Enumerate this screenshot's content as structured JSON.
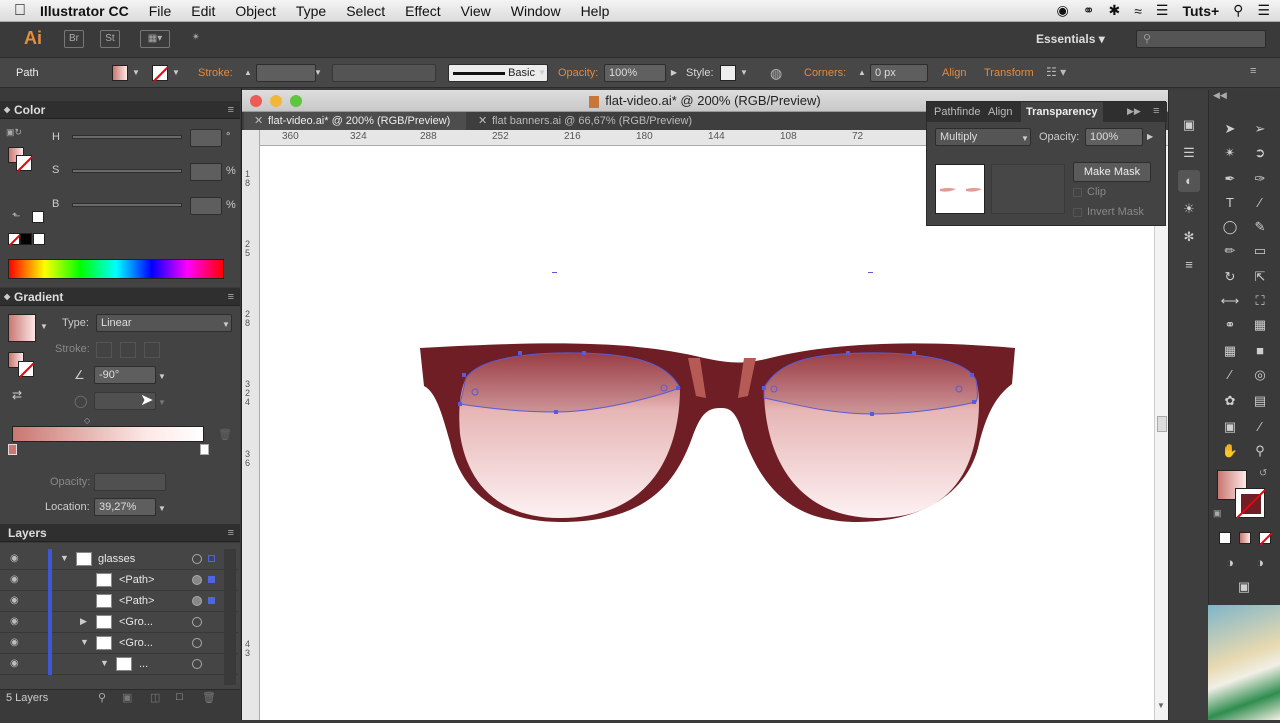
{
  "menubar": {
    "app_name": "Illustrator CC",
    "items": [
      "File",
      "Edit",
      "Object",
      "Type",
      "Select",
      "Effect",
      "View",
      "Window",
      "Help"
    ],
    "right_label": "Tuts+"
  },
  "appbar": {
    "logo": "Ai",
    "bridge_label": "Br",
    "stock_label": "St",
    "workspace": "Essentials",
    "search_placeholder": ""
  },
  "control": {
    "selection_type": "Path",
    "stroke_label": "Stroke:",
    "brush_style": "Basic",
    "opacity_label": "Opacity:",
    "opacity_value": "100%",
    "style_label": "Style:",
    "corners_label": "Corners:",
    "corners_value": "0 px",
    "align_label": "Align",
    "transform_label": "Transform"
  },
  "color_panel": {
    "title": "Color",
    "h_label": "H",
    "s_label": "S",
    "b_label": "B",
    "h_unit": "°",
    "s_unit": "%",
    "b_unit": "%"
  },
  "gradient_panel": {
    "title": "Gradient",
    "type_label": "Type:",
    "type_value": "Linear",
    "stroke_label": "Stroke:",
    "angle_value": "-90°",
    "opacity_label": "Opacity:",
    "location_label": "Location:",
    "location_value": "39,27%"
  },
  "document": {
    "window_title": "flat-video.ai* @ 200% (RGB/Preview)",
    "tabs": [
      {
        "label": "flat-video.ai* @ 200% (RGB/Preview)",
        "active": true
      },
      {
        "label": "flat banners.ai @ 66,67% (RGB/Preview)",
        "active": false
      }
    ],
    "ruler_h_ticks": [
      "360",
      "324",
      "288",
      "252",
      "216",
      "180",
      "144",
      "108",
      "72"
    ],
    "ruler_v_ticks": [
      "1 8",
      "2 5",
      "2 8",
      "3 2 4",
      "3 6",
      "4 3"
    ]
  },
  "transparency_panel": {
    "tabs": [
      "Pathfinde",
      "Align",
      "Transparency"
    ],
    "blend_mode": "Multiply",
    "opacity_label": "Opacity:",
    "opacity_value": "100%",
    "make_mask": "Make Mask",
    "clip": "Clip",
    "invert_mask": "Invert Mask"
  },
  "layers_panel": {
    "title": "Layers",
    "rows": [
      {
        "name": "glasses",
        "expand": "▼"
      },
      {
        "name": "<Path>",
        "expand": ""
      },
      {
        "name": "<Path>",
        "expand": ""
      },
      {
        "name": "<Gro...",
        "expand": "▶"
      },
      {
        "name": "<Gro...",
        "expand": "▼"
      },
      {
        "name": "...",
        "expand": "▼"
      }
    ],
    "footer": "5 Layers"
  },
  "colors": {
    "frame": "#6e1e24",
    "lens_top": "#a8474e",
    "lens_bottom": "#fdf0f1",
    "gradient_start": "#c97771",
    "accent": "#e38b3d"
  }
}
